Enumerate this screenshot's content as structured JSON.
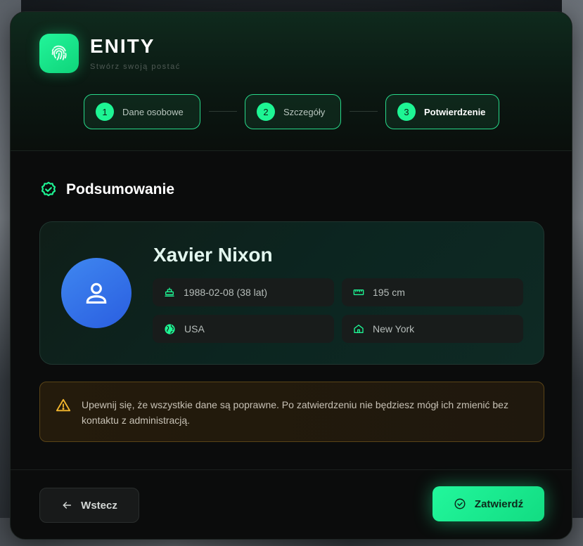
{
  "brand": {
    "title": "ENITY",
    "subtitle": "Stwórz swoją postać"
  },
  "steps": [
    {
      "number": "1",
      "label": "Dane osobowe",
      "active": false
    },
    {
      "number": "2",
      "label": "Szczegóły",
      "active": false
    },
    {
      "number": "3",
      "label": "Potwierdzenie",
      "active": true
    }
  ],
  "summary": {
    "title": "Podsumowanie",
    "character": {
      "name": "Xavier Nixon",
      "birthdate": "1988-02-08 (38 lat)",
      "height": "195 cm",
      "nationality": "USA",
      "city": "New York"
    },
    "icons": {
      "birthdate": "cake-icon",
      "height": "ruler-icon",
      "nationality": "globe-icon",
      "city": "home-icon"
    }
  },
  "warning": {
    "text": "Upewnij się, że wszystkie dane są poprawne. Po zatwierdzeniu nie będziesz mógł ich zmienić bez kontaktu z administracją."
  },
  "footer": {
    "back_label": "Wstecz",
    "confirm_label": "Zatwierdź"
  },
  "colors": {
    "accent": "#1ef594",
    "avatar": "#3a7aee",
    "warning": "#f5b82e"
  }
}
